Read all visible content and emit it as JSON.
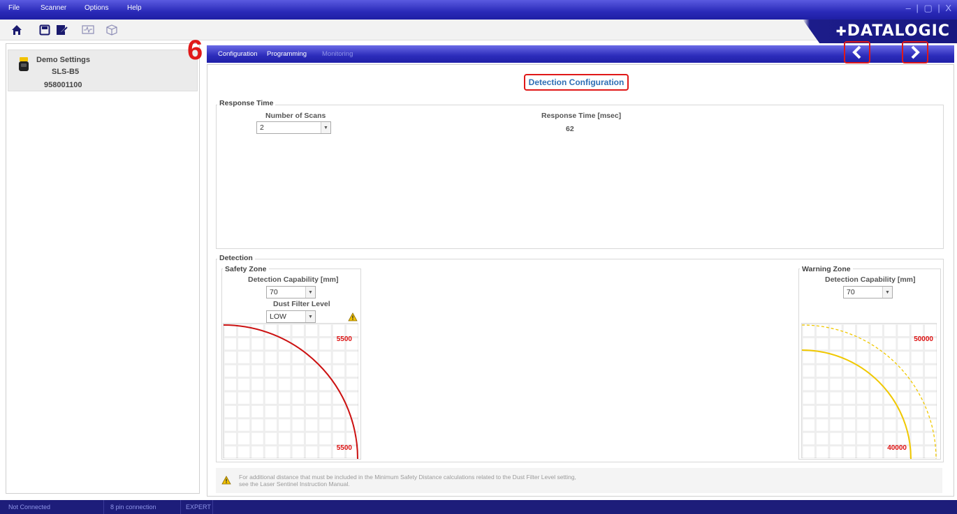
{
  "menubar": {
    "items": [
      "File",
      "Scanner",
      "Options",
      "Help"
    ],
    "window_controls": "– | ▢ | X"
  },
  "toolbar": {
    "icons": [
      "home-icon",
      "save-icon",
      "send-icon",
      "monitor-icon",
      "cube-icon"
    ]
  },
  "brand": {
    "logo": "DATALOGIC"
  },
  "device": {
    "name": "Demo Settings",
    "model": "SLS-B5",
    "serial": "958001100"
  },
  "step_number": "6",
  "tabs": [
    {
      "label": "Configuration",
      "enabled": true
    },
    {
      "label": "Programming",
      "enabled": true
    },
    {
      "label": "Monitoring",
      "enabled": false
    }
  ],
  "page": {
    "title": "Detection Configuration"
  },
  "response_time": {
    "legend": "Response Time",
    "scans_label": "Number of Scans",
    "scans_value": "2",
    "response_label": "Response Time [msec]",
    "response_value": "62"
  },
  "detection": {
    "legend": "Detection",
    "safety": {
      "legend": "Safety Zone",
      "capability_label": "Detection Capability [mm]",
      "capability_value": "70",
      "dust_label": "Dust Filter Level",
      "dust_value": "LOW",
      "range_top": "5500",
      "range_bottom": "5500",
      "color": "#cc1111"
    },
    "warning": {
      "legend": "Warning Zone",
      "capability_label": "Detection Capability [mm]",
      "capability_value": "70",
      "range_top": "50000",
      "range_bottom": "40000",
      "color": "#f0c800"
    }
  },
  "note": {
    "line1": "For additional distance that must be included in the Minimum Safety Distance calculations related to the Dust Filter Level setting,",
    "line2": "see the Laser Sentinel Instruction Manual."
  },
  "status": {
    "connection": "Not Connected",
    "pin": "8 pin connection",
    "mode": "EXPERT"
  }
}
